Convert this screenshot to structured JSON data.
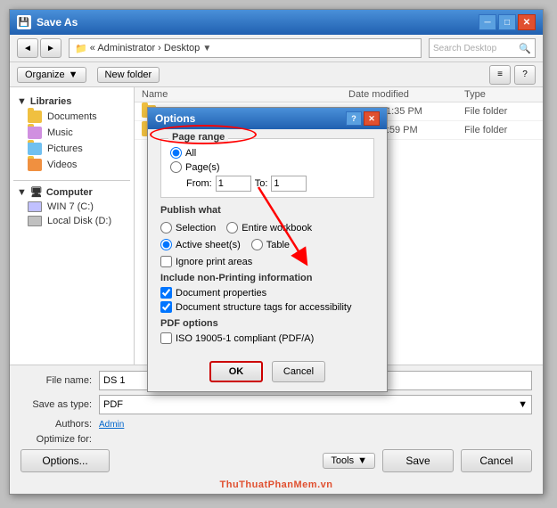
{
  "window": {
    "title": "Save As",
    "address_path": "« Administrator › Desktop",
    "search_placeholder": "Search Desktop",
    "organize_label": "Organize",
    "new_folder_label": "New folder",
    "help_icon": "?"
  },
  "sidebar": {
    "sections": [
      {
        "header": "Libraries",
        "items": [
          "Documents",
          "Music",
          "Pictures",
          "Videos"
        ]
      },
      {
        "header": "Computer",
        "items": [
          "WIN 7 (C:)",
          "Local Disk (D:)"
        ]
      }
    ]
  },
  "file_list": {
    "columns": [
      "Name",
      "Date modified",
      "Type"
    ],
    "rows": [
      {
        "name": "",
        "date": "7/2016 11:35 PM",
        "type": "File folder"
      },
      {
        "name": "",
        "date": "6/2016 5:59 PM",
        "type": "File folder"
      }
    ]
  },
  "bottom": {
    "file_name_label": "File name:",
    "file_name_value": "DS 1",
    "save_as_type_label": "Save as type:",
    "save_as_type_value": "PDF",
    "authors_label": "Authors:",
    "authors_value": "Admin",
    "optimize_label": "Optimize for:",
    "options_label": "Options...",
    "tools_label": "Tools",
    "save_label": "Save",
    "cancel_label": "Cancel"
  },
  "options_dialog": {
    "title": "Options",
    "help_btn": "?",
    "close_btn": "✕",
    "page_range_section": "Page range",
    "all_label": "All",
    "pages_label": "Page(s)",
    "from_label": "From:",
    "from_value": "1",
    "to_label": "To:",
    "to_value": "1",
    "publish_what_title": "Publish what",
    "selection_label": "Selection",
    "entire_workbook_label": "Entire workbook",
    "active_sheets_label": "Active sheet(s)",
    "table_label": "Table",
    "ignore_print_areas_label": "Ignore print areas",
    "non_printing_title": "Include non-Printing information",
    "document_properties_label": "Document properties",
    "document_structure_label": "Document structure tags for accessibility",
    "pdf_options_title": "PDF options",
    "iso_label": "ISO 19005-1 compliant (PDF/A)",
    "ok_label": "OK",
    "cancel_label": "Cancel"
  },
  "watermark": "ThuThuatPhanMem.vn"
}
